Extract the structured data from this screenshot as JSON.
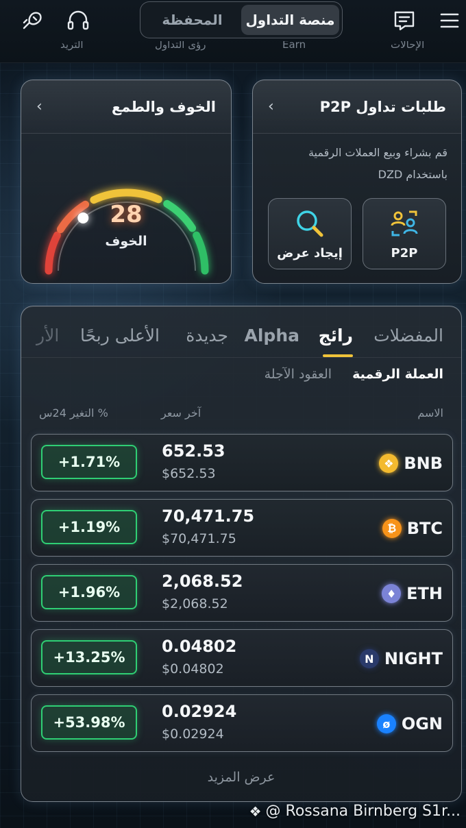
{
  "header": {
    "tabs": [
      {
        "label": "منصة التداول",
        "active": true
      },
      {
        "label": "المحفظة",
        "active": false
      }
    ],
    "subnav": [
      "التريد",
      "رؤى التداول",
      "Earn",
      "الإحالات"
    ]
  },
  "fear_greed": {
    "title": "الخوف والطمع",
    "value": "28",
    "label": "الخوف",
    "level": 0.28
  },
  "p2p": {
    "title": "طلبات تداول P2P",
    "description_line1": "قم بشراء وبيع العملات الرقمية",
    "description_line2": "باستخدام DZD",
    "buttons": [
      {
        "label": "P2P",
        "icon": "p2p-users-icon"
      },
      {
        "label": "إيجاد عرض",
        "icon": "search-icon"
      }
    ]
  },
  "market": {
    "tabs": [
      {
        "label": "المفضلات",
        "active": false
      },
      {
        "label": "رائج",
        "active": true
      },
      {
        "label": "Alpha",
        "active": false
      },
      {
        "label": "جديدة",
        "active": false
      },
      {
        "label": "الأعلى ربحًا",
        "active": false
      },
      {
        "label": "الأر",
        "active": false
      }
    ],
    "subtabs": [
      {
        "label": "العملة الرقمية",
        "active": true
      },
      {
        "label": "العقود الآجلة",
        "active": false
      }
    ],
    "columns": {
      "name": "الاسم",
      "last_price": "آخر سعر",
      "change": "% التغير 24س"
    },
    "rows": [
      {
        "symbol": "BNB",
        "price": "652.53",
        "price_usd": "$652.53",
        "change": "+1.71%",
        "icon_color": "#f3ba2f"
      },
      {
        "symbol": "BTC",
        "price": "70,471.75",
        "price_usd": "$70,471.75",
        "change": "+1.19%",
        "icon_color": "#f7931a"
      },
      {
        "symbol": "ETH",
        "price": "2,068.52",
        "price_usd": "$2,068.52",
        "change": "+1.96%",
        "icon_color": "#7b83d6"
      },
      {
        "symbol": "NIGHT",
        "price": "0.04802",
        "price_usd": "$0.04802",
        "change": "+13.25%",
        "icon_color": "#2a3a6a"
      },
      {
        "symbol": "OGN",
        "price": "0.02924",
        "price_usd": "$0.02924",
        "change": "+53.98%",
        "icon_color": "#1a82ff"
      }
    ],
    "show_more": "عرض المزيد"
  },
  "watermark": "@ Rossana Birnberg S1r...",
  "colors": {
    "accent": "#f0c33a",
    "positive": "#2fcf74"
  }
}
